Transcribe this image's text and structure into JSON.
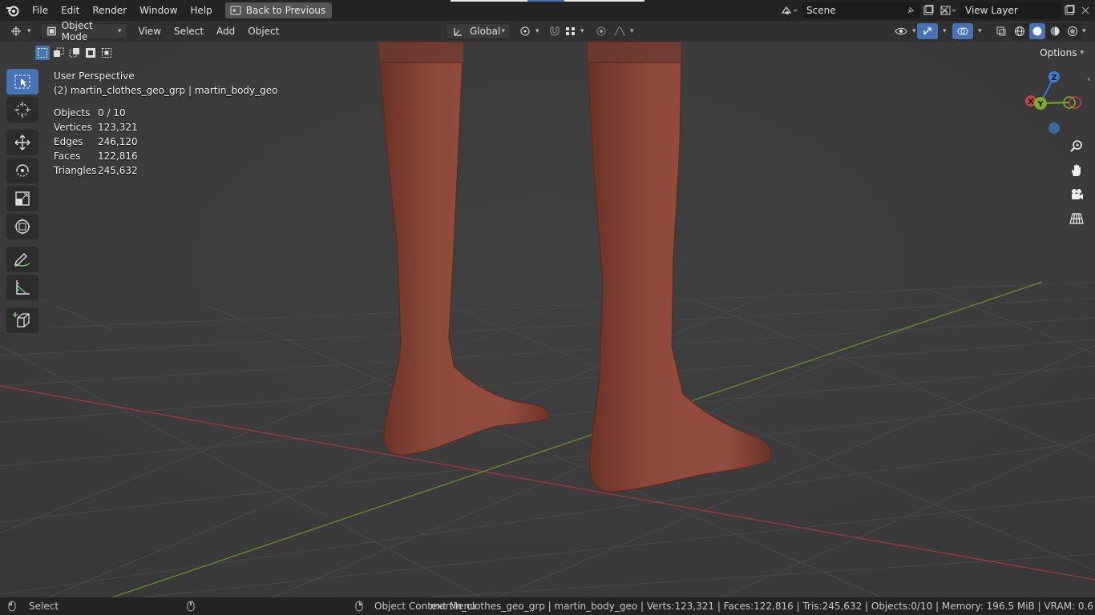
{
  "topbar": {
    "menus": [
      "File",
      "Edit",
      "Render",
      "Window",
      "Help"
    ],
    "back_label": "Back to Previous",
    "scene_name": "Scene",
    "view_layer": "View Layer"
  },
  "header": {
    "mode": "Object Mode",
    "menus": [
      "View",
      "Select",
      "Add",
      "Object"
    ],
    "orientation": "Global",
    "options_label": "Options"
  },
  "overlay": {
    "view_name": "User Perspective",
    "collection_object": "(2) martin_clothes_geo_grp | martin_body_geo"
  },
  "stats": [
    {
      "key": "Objects",
      "value": "0 / 10"
    },
    {
      "key": "Vertices",
      "value": "123,321"
    },
    {
      "key": "Edges",
      "value": "246,120"
    },
    {
      "key": "Faces",
      "value": "122,816"
    },
    {
      "key": "Triangles",
      "value": "245,632"
    }
  ],
  "gizmo": {
    "z": "Z",
    "y": "Y",
    "x": "X"
  },
  "statusbar": {
    "left_label": "Select",
    "context_label": "Object Context Menu",
    "info": "martin_clothes_geo_grp | martin_body_geo | Verts:123,321 | Faces:122,816 | Tris:245,632 | Objects:0/10 | Memory: 196.5 MiB | VRAM: 0.6"
  },
  "colors": {
    "accent": "#4772b3",
    "skin": "#8a4a3c",
    "x_axis": "#c0434a",
    "y_axis": "#7dad2d",
    "z_axis": "#3a7fd6"
  }
}
